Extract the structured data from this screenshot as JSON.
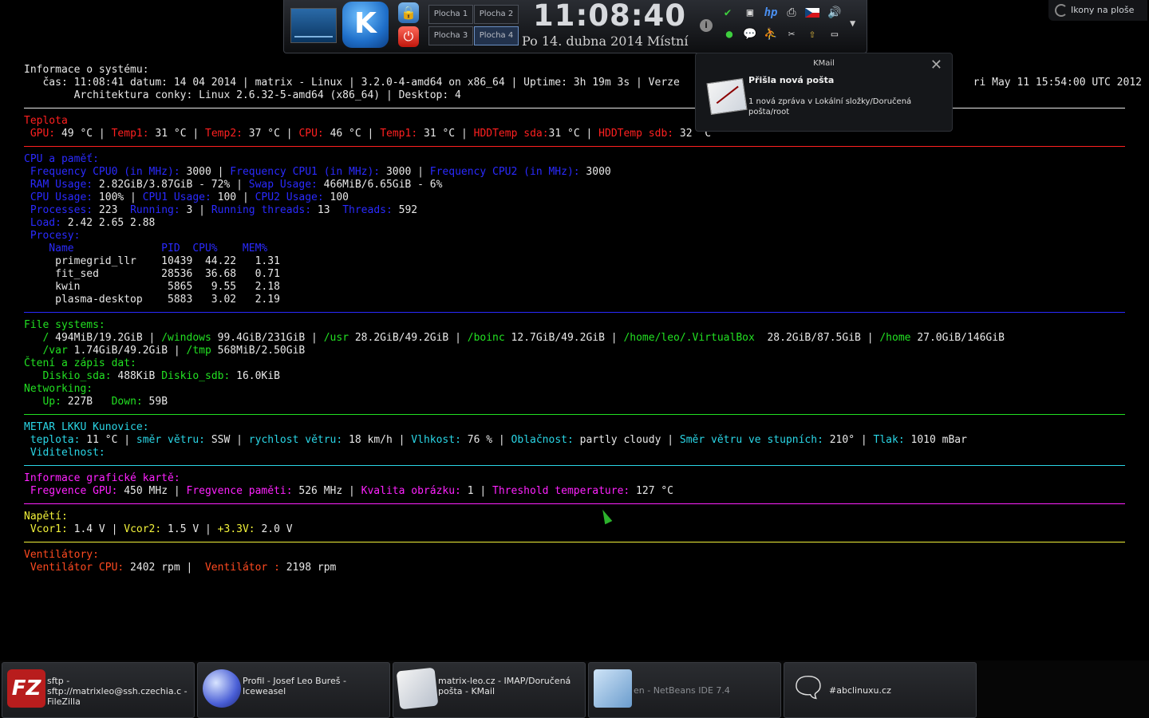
{
  "panel": {
    "kde_logo_text": "K",
    "pagers": [
      "Plocha 1",
      "Plocha 2",
      "Plocha 3",
      "Plocha 4"
    ],
    "clock_time": "11:08:40",
    "clock_date": "Po 14. dubna 2014 Místní",
    "tray_icons": [
      "shield-check-icon",
      "network-icon",
      "hp-printer-icon",
      "printer-icon",
      "czech-flag-icon",
      "volume-icon",
      "green-dot-icon",
      "chat-icon",
      "accessibility-icon",
      "scissors-icon",
      "updates-icon",
      "display-icon"
    ],
    "info_label": "i"
  },
  "desktop_icons": {
    "label": "Ikony na ploše"
  },
  "notification": {
    "app": "KMail",
    "title": "Přišla nová pošta",
    "body": "1 nová zpráva v Lokální složky/Doručená pošta/root"
  },
  "conky": {
    "system_header": "Informace o systému:",
    "system_line1": "   čas: 11:08:41 datum: 14 04 2014 | matrix - Linux | 3.2.0-4-amd64 on x86_64 | Uptime: 3h 19m 3s | Verze                                               ri May 11 15:54:00 UTC 2012",
    "system_line2": "        Architektura conky: Linux 2.6.32-5-amd64 (x86_64) | Desktop: 4",
    "temp_header": "Teplota",
    "temp": {
      "gpu_label": " GPU:",
      "gpu_val": " 49 °C | ",
      "temp1_label": "Temp1:",
      "temp1_val": " 31 °C | ",
      "temp2_label": "Temp2:",
      "temp2_val": " 37 °C | ",
      "cpu_label": "CPU:",
      "cpu_val": " 46 °C | ",
      "temp1b_label": "Temp1:",
      "temp1b_val": " 31 °C | ",
      "hdd_sda_label": "HDDTemp sda:",
      "hdd_sda_val": "31 °C | ",
      "hdd_sdb_label": "HDDTemp sdb:",
      "hdd_sdb_val": " 32 °C"
    },
    "cpu_header": "CPU a paměť:",
    "freq": {
      "f0_label": " Frequency CPU0 (in MHz):",
      "f0_val": " 3000 | ",
      "f1_label": "Frequency CPU1 (in MHz):",
      "f1_val": " 3000 | ",
      "f2_label": "Frequency CPU2 (in MHz):",
      "f2_val": " 3000"
    },
    "mem": {
      "ram_label": " RAM Usage:",
      "ram_val": " 2.82GiB/3.87GiB - 72% | ",
      "swap_label": "Swap Usage:",
      "swap_val": " 466MiB/6.65GiB - 6%"
    },
    "usage": {
      "cpu_label": " CPU Usage:",
      "cpu_val": " 100% | ",
      "cpu1_label": "CPU1 Usage:",
      "cpu1_val": " 100 | ",
      "cpu2_label": "CPU2 Usage:",
      "cpu2_val": " 100"
    },
    "procs": {
      "p_label": " Processes:",
      "p_val": " 223  ",
      "r_label": "Running:",
      "r_val": " 3 | ",
      "rt_label": "Running threads:",
      "rt_val": " 13  ",
      "t_label": "Threads:",
      "t_val": " 592"
    },
    "load": {
      "label": " Load:",
      "val": " 2.42 2.65 2.88"
    },
    "proc_header": " Procesy:",
    "proc_columns": "    Name              PID  CPU%    MEM%",
    "proc_rows": [
      "     primegrid_llr    10439  44.22   1.31",
      "     fit_sed          28536  36.68   0.71",
      "     kwin              5865   9.55   2.18",
      "     plasma-desktop    5883   3.02   2.19"
    ],
    "fs_header": "File systems:",
    "fs1": {
      "a_label": "   /",
      "a_val": " 494MiB/19.2GiB | ",
      "b_label": "/windows",
      "b_val": " 99.4GiB/231GiB | ",
      "c_label": "/usr",
      "c_val": " 28.2GiB/49.2GiB | ",
      "d_label": "/boinc",
      "d_val": " 12.7GiB/49.2GiB | ",
      "e_label": "/home/leo/.VirtualBox",
      "e_val": "  28.2GiB/87.5GiB | ",
      "f_label": "/home",
      "f_val": " 27.0GiB/146GiB"
    },
    "fs2": {
      "a_label": "   /var",
      "a_val": " 1.74GiB/49.2GiB | ",
      "b_label": "/tmp",
      "b_val": " 568MiB/2.50GiB"
    },
    "io_header": "Čtení a zápis dat:",
    "io": {
      "sda_label": "   Diskio_sda:",
      "sda_val": " 488KiB ",
      "sdb_label": "Diskio_sdb:",
      "sdb_val": " 16.0KiB"
    },
    "net_header": "Networking:",
    "net": {
      "up_label": "   Up:",
      "up_val": " 227B   ",
      "down_label": "Down:",
      "down_val": " 59B"
    },
    "metar_header": "METAR LKKU Kunovice:",
    "metar": {
      "t_label": " teplota:",
      "t_val": " 11 °C | ",
      "dir_label": "směr větru:",
      "dir_val": " SSW | ",
      "spd_label": "rychlost větru:",
      "spd_val": " 18 km/h | ",
      "hum_label": "Vlhkost:",
      "hum_val": " 76 % | ",
      "cl_label": "Oblačnost:",
      "cl_val": " partly cloudy | ",
      "deg_label": "Směr větru ve stupních:",
      "deg_val": " 210° | ",
      "p_label": "Tlak:",
      "p_val": " 1010 mBar"
    },
    "metar_vis": " Viditelnost:",
    "gpu_header": "Informace grafické kartě:",
    "gpu": {
      "f_label": " Fregvence GPU:",
      "f_val": " 450 MHz | ",
      "m_label": "Fregvence paměti:",
      "m_val": " 526 MHz | ",
      "q_label": "Kvalita obrázku:",
      "q_val": " 1 | ",
      "th_label": "Threshold temperature:",
      "th_val": " 127 °C"
    },
    "volt_header": "Napětí:",
    "volt": {
      "v1_label": " Vcor1:",
      "v1_val": " 1.4 V | ",
      "v2_label": "Vcor2:",
      "v2_val": " 1.5 V | ",
      "v3_label": "+3.3V:",
      "v3_val": " 2.0 V"
    },
    "fan_header": "Ventilátory:",
    "fan": {
      "cpu_label": " Ventilátor CPU:",
      "cpu_val": " 2402 rpm |  ",
      "f2_label": "Ventilátor :",
      "f2_val": " 2198 rpm"
    }
  },
  "taskbar": [
    {
      "label": "sftp - sftp://matrixleo@ssh.czechia.c - FileZilla",
      "icon": "filezilla-icon"
    },
    {
      "label": "Profil - Josef Leo Bureš - Iceweasel",
      "icon": "iceweasel-icon"
    },
    {
      "label": "matrix-leo.cz - IMAP/Doručená pošta - KMail",
      "icon": "kmail-icon"
    },
    {
      "label": "en - NetBeans IDE 7.4",
      "icon": "netbeans-icon"
    },
    {
      "label": "#abclinuxu.cz",
      "icon": "chat-icon"
    }
  ],
  "colors": {
    "red": "#ff2020",
    "blue": "#2a2aff",
    "green": "#22e022",
    "cyan": "#2ad6e6",
    "magenta": "#ff22ff",
    "yellow": "#f2f23a",
    "orange": "#ff4a20"
  }
}
